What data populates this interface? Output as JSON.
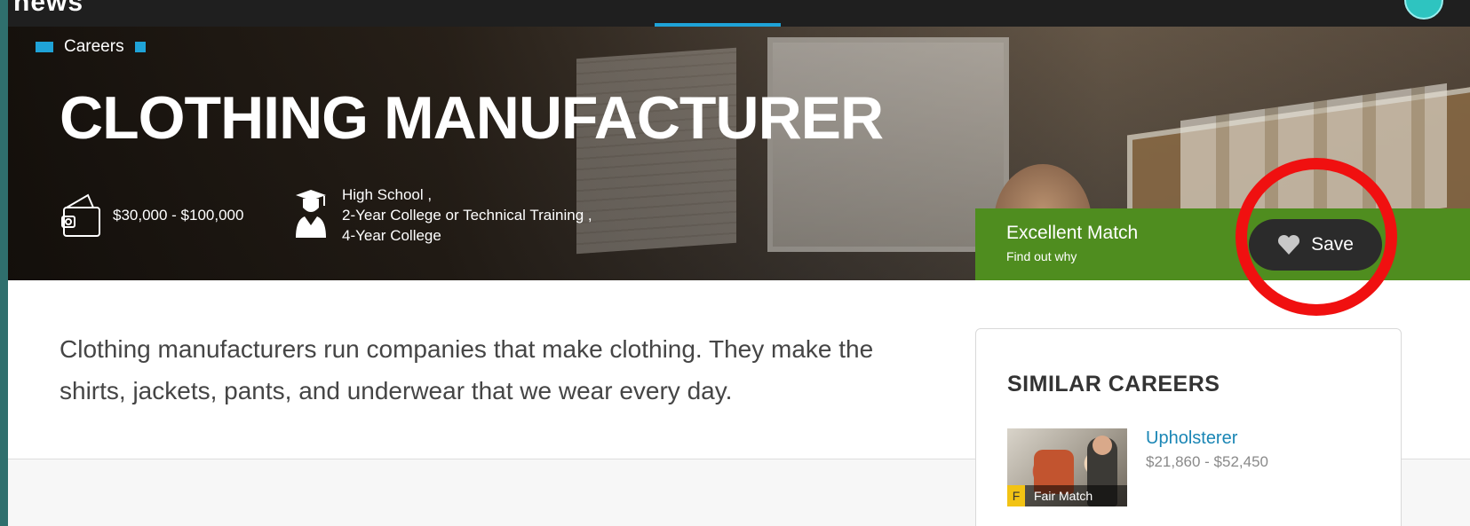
{
  "nav": {
    "logo_partial": "news"
  },
  "breadcrumb": {
    "label": "Careers"
  },
  "career": {
    "title": "CLOTHING MANUFACTURER",
    "salary_range": "$30,000 - $100,000",
    "education": [
      "High School ,",
      "2-Year College or Technical Training ,",
      "4-Year College"
    ],
    "description": "Clothing manufacturers run companies that make clothing. They make the shirts, jackets, pants, and underwear that we wear every day."
  },
  "match": {
    "label": "Excellent Match",
    "link": "Find out why",
    "save_label": "Save"
  },
  "similar_careers": {
    "heading": "SIMILAR CAREERS",
    "items": [
      {
        "name": "Upholsterer",
        "salary": "$21,860 - $52,450",
        "badge_letter": "F",
        "badge_text": "Fair Match"
      }
    ]
  },
  "colors": {
    "accent_blue": "#1fa3d8",
    "match_green": "#4f8d1f",
    "annotation_red": "#f01010",
    "fair_yellow": "#f2c314",
    "link_blue": "#1a86b5"
  },
  "icons": [
    "wallet-icon",
    "graduate-icon",
    "heart-icon"
  ]
}
